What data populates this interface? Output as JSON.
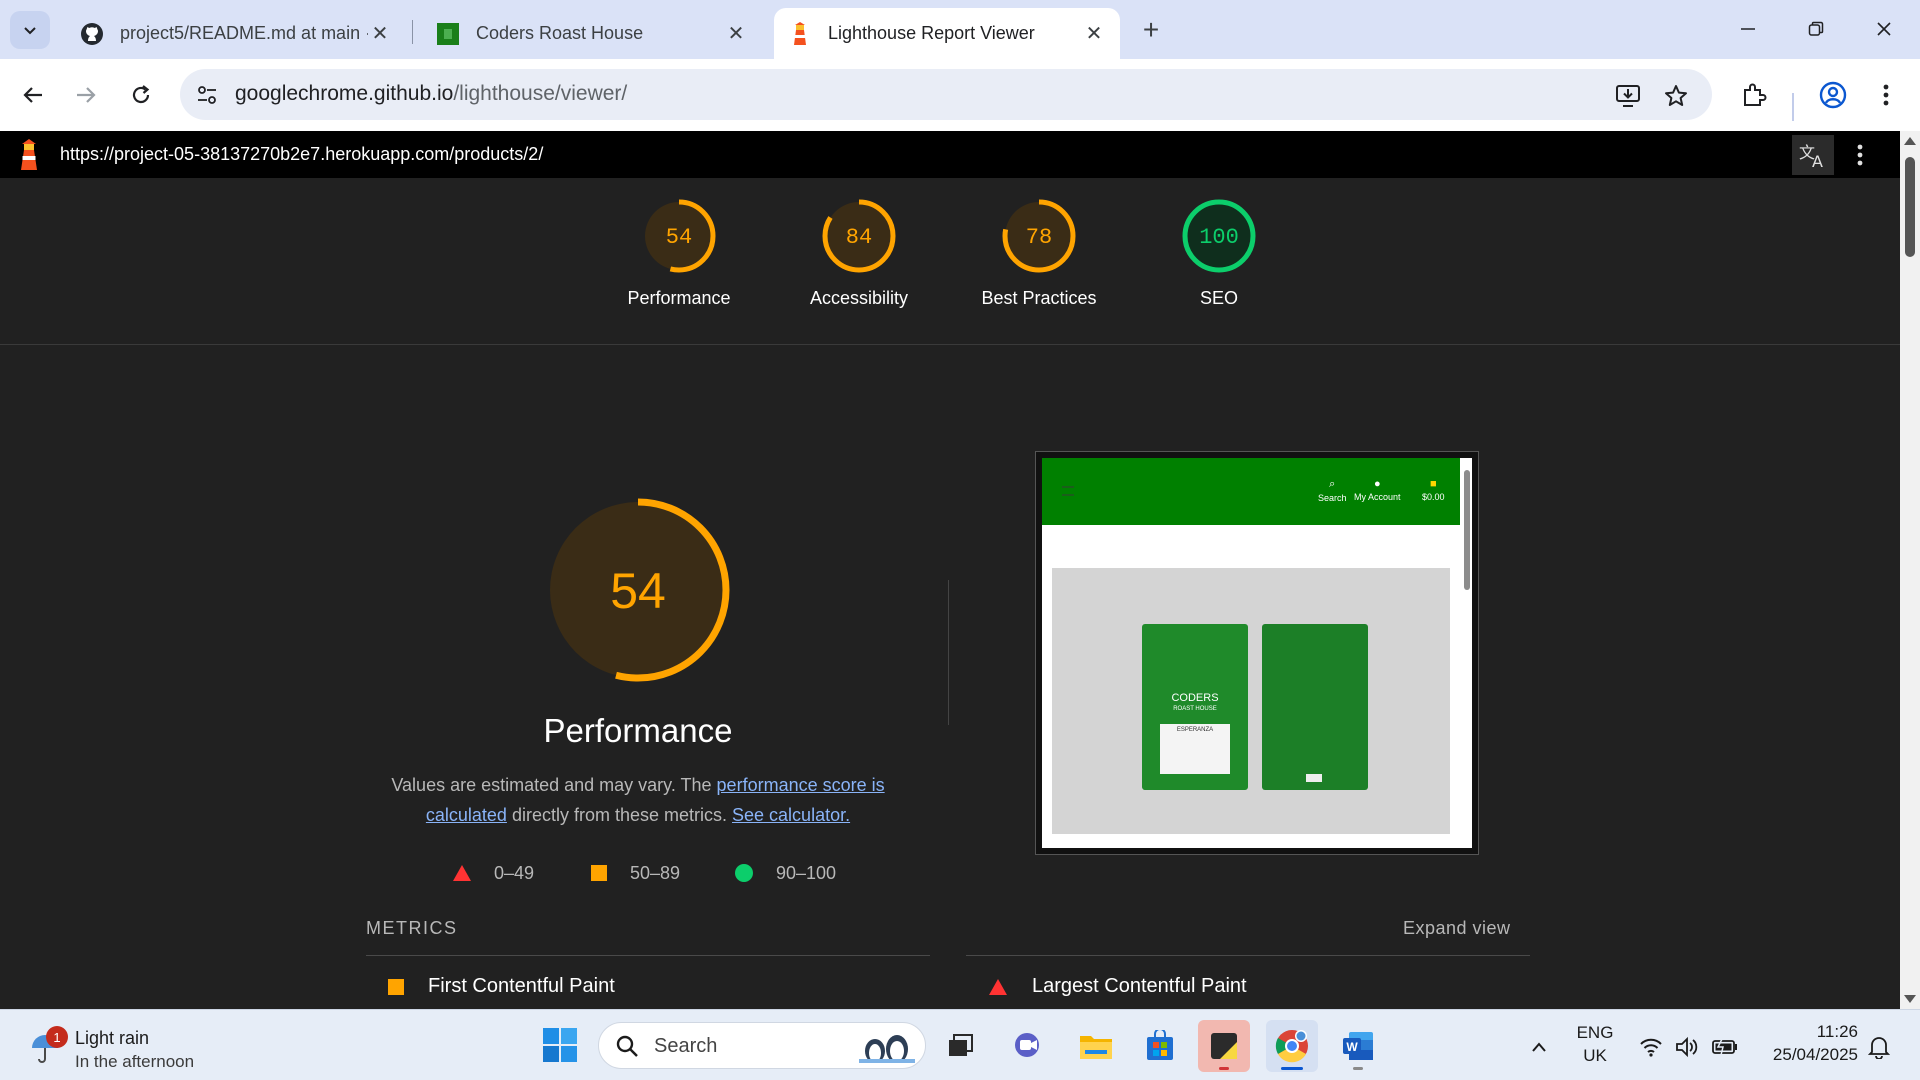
{
  "browser": {
    "tabs": [
      {
        "title": "project5/README.md at main ·",
        "icon": "github-icon",
        "active": false
      },
      {
        "title": "Coders Roast House",
        "icon": "coders-roast-favicon",
        "active": false
      },
      {
        "title": "Lighthouse Report Viewer",
        "icon": "lighthouse-icon",
        "active": true
      }
    ],
    "url_host": "googlechrome.github.io",
    "url_path": "/lighthouse/viewer/"
  },
  "lighthouse": {
    "report_url": "https://project-05-38137270b2e7.herokuapp.com/products/2/",
    "scores": [
      {
        "label": "Performance",
        "value": "54",
        "fraction": 0.54,
        "color": "#ffa400"
      },
      {
        "label": "Accessibility",
        "value": "84",
        "fraction": 0.84,
        "color": "#ffa400"
      },
      {
        "label": "Best Practices",
        "value": "78",
        "fraction": 0.78,
        "color": "#ffa400"
      },
      {
        "label": "SEO",
        "value": "100",
        "fraction": 1.0,
        "color": "#0cce6b"
      }
    ],
    "performance": {
      "score": "54",
      "fraction": 0.54,
      "title": "Performance",
      "desc_prefix": "Values are estimated and may vary. The ",
      "desc_link1": "performance score is calculated",
      "desc_middle": " directly from these metrics. ",
      "desc_link2": "See calculator."
    },
    "legend": [
      {
        "range": "0–49",
        "shape": "triangle",
        "color": "#ff3333"
      },
      {
        "range": "50–89",
        "shape": "square",
        "color": "#ffa400"
      },
      {
        "range": "90–100",
        "shape": "circle",
        "color": "#0cce6b"
      }
    ],
    "metrics_label": "METRICS",
    "expand_label": "Expand view",
    "metrics": [
      {
        "name": "First Contentful Paint",
        "rating": "square"
      },
      {
        "name": "Largest Contentful Paint",
        "rating": "triangle"
      }
    ],
    "thumbnail": {
      "nav": [
        "Search",
        "My Account",
        "$0.00"
      ],
      "bag_brand": "CODERS",
      "bag_sub": "ROAST HOUSE",
      "bag_label": "ESPERANZA"
    }
  },
  "taskbar": {
    "weather_title": "Light rain",
    "weather_sub": "In the afternoon",
    "weather_badge": "1",
    "search_label": "Search",
    "lang_line1": "ENG",
    "lang_line2": "UK",
    "time": "11:26",
    "date": "25/04/2025"
  }
}
